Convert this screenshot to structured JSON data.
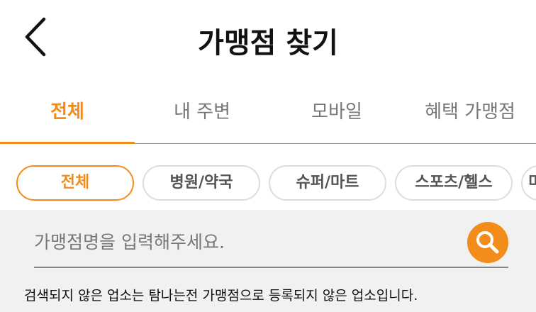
{
  "header": {
    "title": "가맹점 찾기",
    "back_icon": "chevron-left-icon"
  },
  "tabs": [
    {
      "label": "전체",
      "active": true
    },
    {
      "label": "내 주변",
      "active": false
    },
    {
      "label": "모바일",
      "active": false
    },
    {
      "label": "혜택 가맹점",
      "active": false
    }
  ],
  "categories": [
    {
      "label": "전체",
      "active": true
    },
    {
      "label": "병원/약국",
      "active": false
    },
    {
      "label": "슈퍼/마트",
      "active": false
    },
    {
      "label": "스포츠/헬스",
      "active": false
    },
    {
      "label": "미",
      "active": false
    }
  ],
  "search": {
    "placeholder": "가맹점명을 입력해주세요.",
    "value": "",
    "button_icon": "search-icon"
  },
  "notice": "검색되지 않은 업소는 탐나는전 가맹점으로 등록되지 않은 업소입니다.",
  "colors": {
    "accent": "#f28c1a",
    "tab_inactive": "#777777",
    "chip_border": "#dddddd",
    "search_bg": "#f1f1f1"
  }
}
